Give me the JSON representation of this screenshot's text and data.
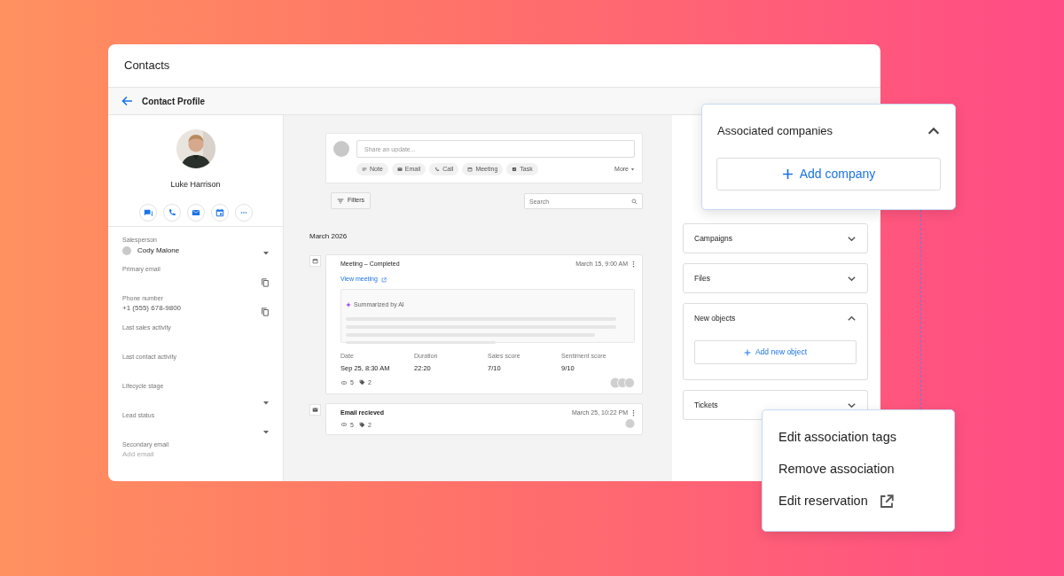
{
  "window": {
    "title": "Contacts"
  },
  "header": {
    "title": "Contact Profile"
  },
  "profile": {
    "name": "Luke Harrison",
    "actions": [
      {
        "kind": "message"
      },
      {
        "kind": "phone"
      },
      {
        "kind": "email"
      },
      {
        "kind": "calendar"
      },
      {
        "kind": "more"
      }
    ]
  },
  "fields": [
    {
      "label": "Salesperson",
      "kind": "person-select",
      "value": "Cody Malone"
    },
    {
      "label": "Primary email",
      "kind": "copy"
    },
    {
      "label": "Phone number",
      "kind": "copy",
      "value": "+1 (555) 678-9800"
    },
    {
      "label": "Last sales activity",
      "kind": "text"
    },
    {
      "label": "Last contact activity",
      "kind": "text"
    },
    {
      "label": "Lifecycle stage",
      "kind": "select"
    },
    {
      "label": "Lead status",
      "kind": "select"
    },
    {
      "label": "Secondary email",
      "kind": "add",
      "placeholder": "Add email"
    }
  ],
  "composer": {
    "placeholder": "Share an update...",
    "chips": [
      {
        "label": "Note",
        "kind": "note"
      },
      {
        "label": "Email",
        "kind": "email"
      },
      {
        "label": "Call",
        "kind": "call"
      },
      {
        "label": "Meeting",
        "kind": "meeting"
      },
      {
        "label": "Task",
        "kind": "task"
      }
    ],
    "more": "More"
  },
  "filters": {
    "label": "Filters",
    "search_placeholder": "Search"
  },
  "timeline": {
    "month": "March 2026",
    "items": [
      {
        "kind": "meeting",
        "title": "Meeting – Completed",
        "time": "March 15, 9:00 AM",
        "link": "View meeting",
        "summary_label": "Summarized by AI",
        "stats": [
          {
            "label": "Date",
            "value": "Sep 25, 8:30 AM"
          },
          {
            "label": "Duration",
            "value": "22:20"
          },
          {
            "label": "Sales score",
            "value": "7/10"
          },
          {
            "label": "Sentiment score",
            "value": "9/10"
          }
        ],
        "links": "5",
        "tags": "2"
      },
      {
        "kind": "email",
        "title": "Email recieved",
        "time": "March 25, 10:22 PM",
        "links": "5",
        "tags": "2"
      }
    ]
  },
  "panels": [
    {
      "title": "Campaigns",
      "expanded": false
    },
    {
      "title": "Files",
      "expanded": false
    },
    {
      "title": "New objects",
      "expanded": true,
      "action": "Add new object"
    },
    {
      "title": "Tickets",
      "expanded": false
    }
  ],
  "associated": {
    "title": "Associated companies",
    "expanded": true,
    "action": "Add company"
  },
  "menu": [
    {
      "label": "Edit association tags",
      "external": false
    },
    {
      "label": "Remove association",
      "external": false
    },
    {
      "label": "Edit reservation",
      "external": true
    }
  ]
}
